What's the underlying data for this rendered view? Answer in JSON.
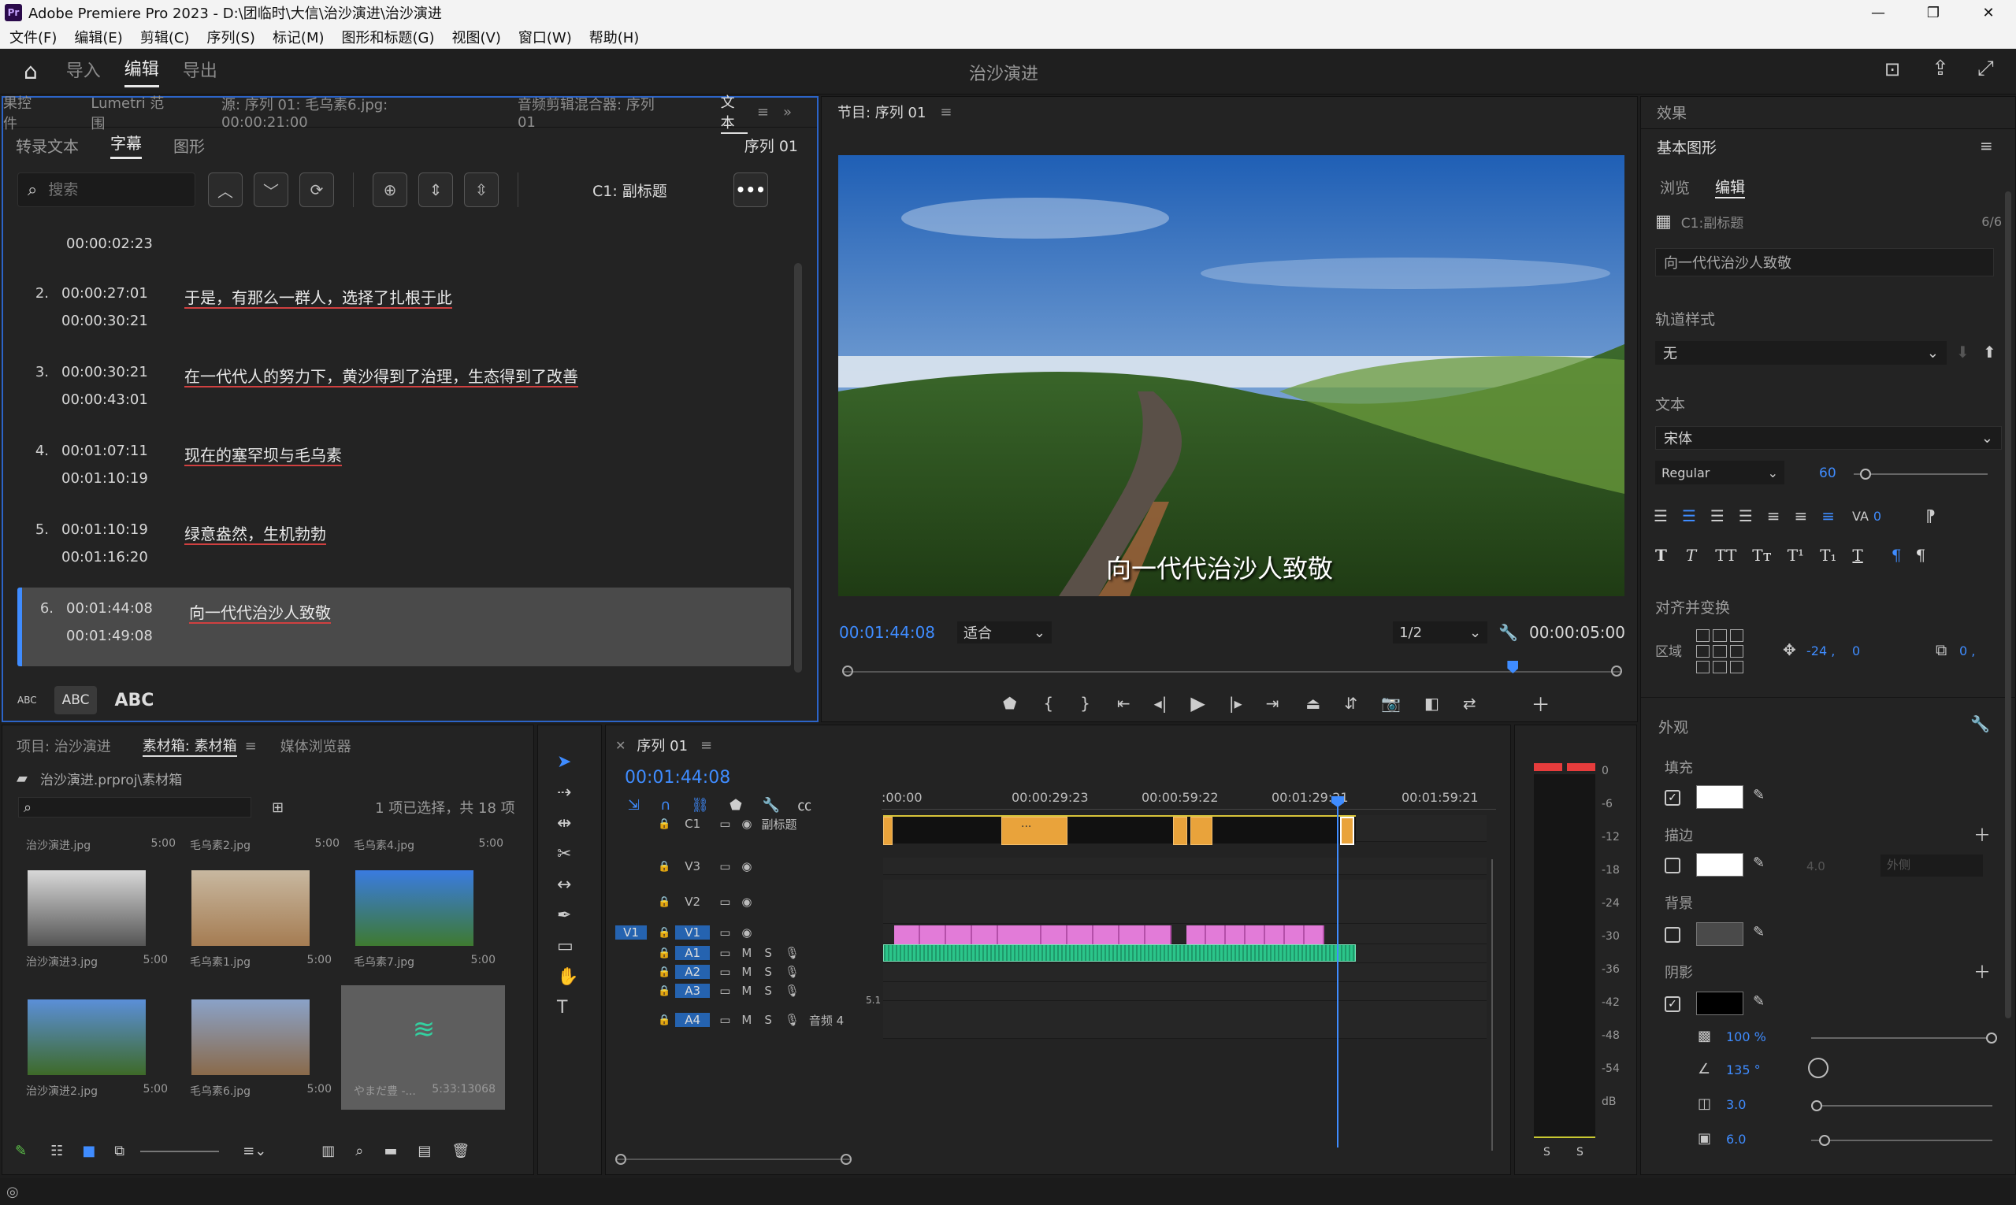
{
  "titlebar": {
    "app_icon": "Pr",
    "title": "Adobe Premiere Pro 2023 - D:\\团临时\\大信\\治沙演进\\治沙演进",
    "min": "—",
    "max": "❐",
    "close": "✕"
  },
  "menu": [
    "文件(F)",
    "编辑(E)",
    "剪辑(C)",
    "序列(S)",
    "标记(M)",
    "图形和标题(G)",
    "视图(V)",
    "窗口(W)",
    "帮助(H)"
  ],
  "workspace": {
    "tabs": [
      "导入",
      "编辑",
      "导出"
    ],
    "active": 1,
    "project_title": "治沙演进"
  },
  "text_panel": {
    "top_tabs": [
      "果控件",
      "Lumetri 范围",
      "源: 序列 01: 毛乌素6.jpg: 00:00:21:00",
      "音频剪辑混合器: 序列 01",
      "文本"
    ],
    "sub_tabs": [
      "转录文本",
      "字幕",
      "图形"
    ],
    "sequence": "序列 01",
    "search_placeholder": "搜索",
    "track_label": "C1: 副标题",
    "partial_time": "00:00:02:23",
    "captions": [
      {
        "n": "2.",
        "in": "00:00:27:01",
        "out": "00:00:30:21",
        "text": "于是，有那么一群人，选择了扎根于此"
      },
      {
        "n": "3.",
        "in": "00:00:30:21",
        "out": "00:00:43:01",
        "text": "在一代代人的努力下，黄沙得到了治理，生态得到了改善"
      },
      {
        "n": "4.",
        "in": "00:01:07:11",
        "out": "00:01:10:19",
        "text": "现在的塞罕坝与毛乌素"
      },
      {
        "n": "5.",
        "in": "00:01:10:19",
        "out": "00:01:16:20",
        "text": "绿意盎然，生机勃勃"
      },
      {
        "n": "6.",
        "in": "00:01:44:08",
        "out": "00:01:49:08",
        "text": "向一代代治沙人致敬"
      }
    ],
    "selected_index": 4,
    "case_buttons": [
      "ABC",
      "ABC",
      "ABC"
    ]
  },
  "program": {
    "title": "节目: 序列 01",
    "timecode": "00:01:44:08",
    "fit": "适合",
    "resolution": "1/2",
    "duration": "00:00:05:00",
    "subtitle_overlay": "向一代代治沙人致敬",
    "playhead_fraction": 0.86
  },
  "project_panel": {
    "tabs": [
      "项目: 治沙演进",
      "素材箱: 素材箱",
      "媒体浏览器"
    ],
    "path": "治沙演进.prproj\\素材箱",
    "selection_info": "1 项已选择，共 18 项",
    "top_row": [
      {
        "name": "治沙演进.jpg",
        "dur": "5:00"
      },
      {
        "name": "毛乌素2.jpg",
        "dur": "5:00"
      },
      {
        "name": "毛乌素4.jpg",
        "dur": "5:00"
      }
    ],
    "items": [
      {
        "name": "治沙演进3.jpg",
        "dur": "5:00"
      },
      {
        "name": "毛乌素1.jpg",
        "dur": "5:00"
      },
      {
        "name": "毛乌素7.jpg",
        "dur": "5:00"
      },
      {
        "name": "治沙演进2.jpg",
        "dur": "5:00"
      },
      {
        "name": "毛乌素6.jpg",
        "dur": "5:00"
      },
      {
        "name": "やまだ豊 -...",
        "dur": "5:33:13068"
      }
    ]
  },
  "timeline": {
    "tab": "序列 01",
    "timecode": "00:01:44:08",
    "ruler": [
      ":00:00",
      "00:00:29:23",
      "00:00:59:22",
      "00:01:29:21",
      "00:01:59:21"
    ],
    "tracks": [
      {
        "id": "C1",
        "name": "副标题"
      },
      {
        "id": "V3",
        "name": ""
      },
      {
        "id": "V2",
        "name": ""
      },
      {
        "id": "V1",
        "name": ""
      },
      {
        "id": "A1",
        "name": ""
      },
      {
        "id": "A2",
        "name": ""
      },
      {
        "id": "A3",
        "name": ""
      },
      {
        "id": "A4",
        "name": "音频 4"
      }
    ],
    "master_value": "5.1",
    "m_label": "M",
    "s_label": "S",
    "caption_clip_label": "..."
  },
  "meter": {
    "scale": [
      "0",
      "-6",
      "-12",
      "-18",
      "-24",
      "-30",
      "-36",
      "-42",
      "-48",
      "-54",
      "dB"
    ],
    "s_buttons": [
      "S",
      "S"
    ]
  },
  "essential_graphics": {
    "panel_title": "效果",
    "title": "基本图形",
    "tabs": [
      "浏览",
      "编辑"
    ],
    "layer": "C1:副标题",
    "layer_count": "6/6",
    "text_value": "向一代代治沙人致敬",
    "track_style_label": "轨道样式",
    "track_style": "无",
    "text_section": "文本",
    "font": "宋体",
    "font_style": "Regular",
    "font_size": "60",
    "tracking": "0",
    "align_section": "对齐并变换",
    "region_label": "区域",
    "pos_x": "-24 ,",
    "pos_y": "0",
    "scale": "0 ,",
    "appearance": "外观",
    "fill": "填充",
    "stroke": "描边",
    "stroke_width": "4.0",
    "stroke_type": "外侧",
    "background": "背景",
    "shadow": "阴影",
    "opacity": "100 %",
    "angle": "135 °",
    "distance": "3.0",
    "size": "6.0",
    "style_glyphs": [
      "T",
      "T",
      "TT",
      "Tт",
      "T¹",
      "T₁",
      "T"
    ]
  },
  "colors": {
    "accent": "#3f8cff",
    "clip_caption": "#e9a33b",
    "clip_video": "#e27bd8",
    "clip_audio": "#2bc58a",
    "panel": "#232323"
  }
}
